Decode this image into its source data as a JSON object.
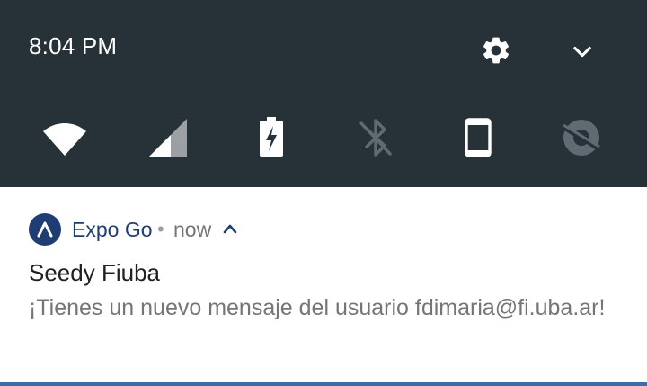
{
  "status_bar": {
    "time": "8:04 PM",
    "icons": [
      "gear-icon",
      "chevron-down-icon"
    ]
  },
  "quick_settings": {
    "tiles": [
      "wifi-icon",
      "cellular-signal-icon",
      "battery-charging-icon",
      "bluetooth-off-icon",
      "screen-rotation-icon",
      "data-saver-off-icon"
    ]
  },
  "notification": {
    "app_icon": "expo-logo-icon",
    "app_name": "Expo Go",
    "separator": "•",
    "when": "now",
    "expand_icon": "chevron-up-icon",
    "title": "Seedy Fiuba",
    "body": "¡Tienes un nuevo mensaje del usuario fdimaria@fi.uba.ar!"
  },
  "colors": {
    "shade_bg": "#263238",
    "accent": "#1f3d73",
    "divider": "#3b6ea8"
  }
}
